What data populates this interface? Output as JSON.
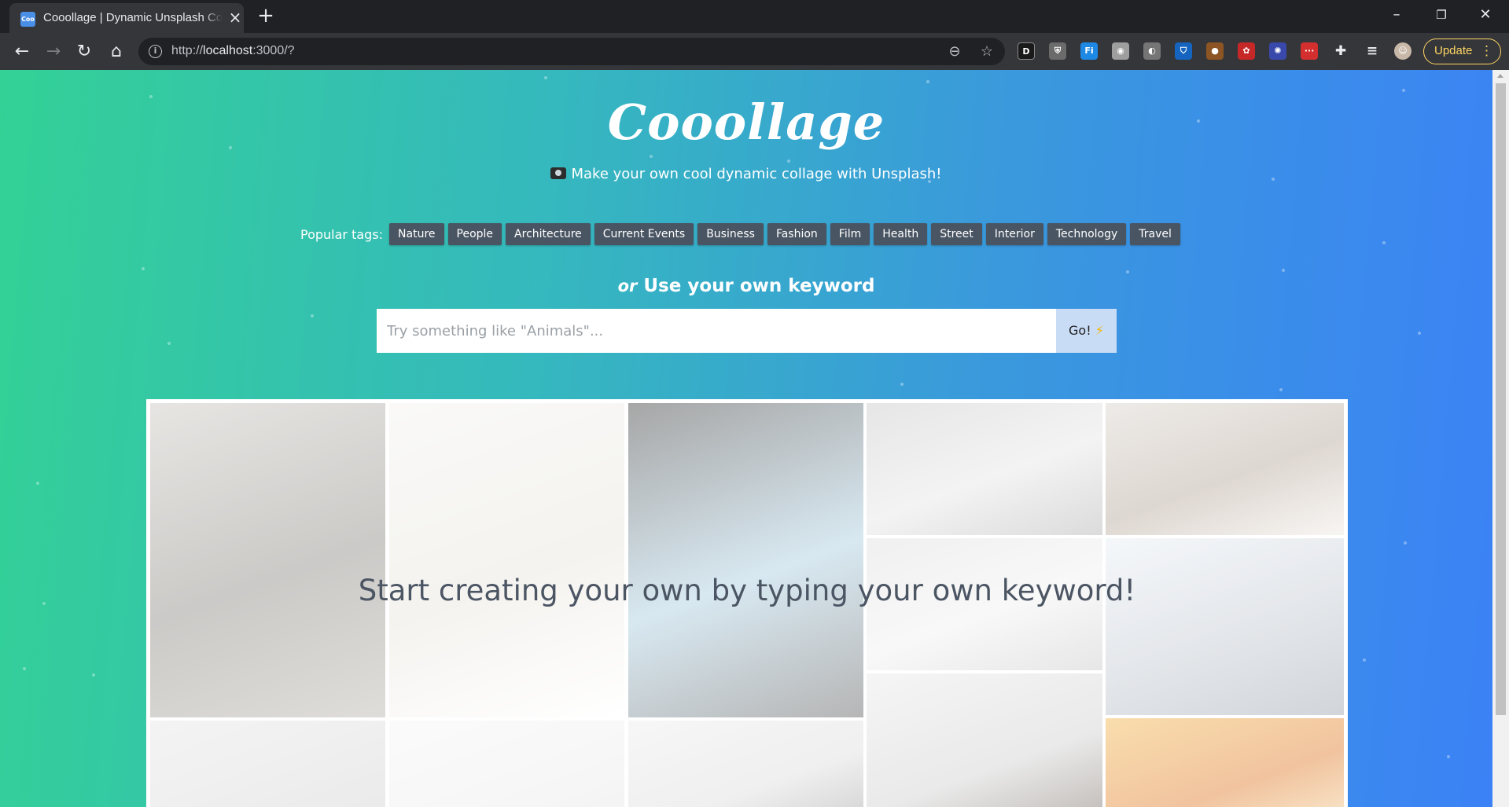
{
  "browser": {
    "tab_title": "Cooollage | Dynamic Unsplash Collage",
    "favicon_text": "Coo",
    "url_scheme": "http://",
    "url_host": "localhost",
    "url_rest": ":3000/?",
    "update_label": "Update"
  },
  "header": {
    "logo": "Cooollage",
    "tagline": "Make your own cool dynamic collage with Unsplash!"
  },
  "tags": {
    "label": "Popular tags:",
    "items": [
      "Nature",
      "People",
      "Architecture",
      "Current Events",
      "Business",
      "Fashion",
      "Film",
      "Health",
      "Street",
      "Interior",
      "Technology",
      "Travel"
    ]
  },
  "search": {
    "or_label": "or",
    "heading": "Use your own keyword",
    "placeholder": "Try something like \"Animals\"...",
    "value": "",
    "button_label": "Go!",
    "button_icon": "⚡"
  },
  "collage": {
    "message": "Start creating your own by typing your own keyword!",
    "tiles": [
      {
        "name": "tower-bridge-photo",
        "colors": [
          "#c9c6c0",
          "#8d8a84",
          "#b8b3ab"
        ]
      },
      {
        "name": "coffee-sunglasses-photo",
        "colors": [
          "#f3f2ef",
          "#e8e4dc",
          "#ffffff"
        ]
      },
      {
        "name": "mountain-silhouette-photo",
        "colors": [
          "#3b3b3b",
          "#a9cde0",
          "#5d5d5d"
        ]
      },
      {
        "name": "bed-sheet-photo",
        "colors": [
          "#c8c8c8",
          "#e5e5e5",
          "#b0b0b0"
        ]
      },
      {
        "name": "woman-camera-photo",
        "colors": [
          "#d8d3cc",
          "#b6a79a",
          "#efeae4"
        ]
      },
      {
        "name": "travel-flatlay-photo",
        "colors": [
          "#dedede",
          "#f0f0f0",
          "#c9c9c9"
        ]
      },
      {
        "name": "snowy-mountains-photo",
        "colors": [
          "#e8eef5",
          "#c2c8d0",
          "#9aa3ad"
        ]
      },
      {
        "name": "woman-back-photo",
        "colors": [
          "#e9e9e9",
          "#cfcfcf",
          "#5b4a40"
        ]
      },
      {
        "name": "flowers-photo",
        "colors": [
          "#f2b54a",
          "#e07b2a",
          "#f7e2a8"
        ]
      },
      {
        "name": "grey-sky-photo",
        "colors": [
          "#e6e6e6",
          "#d9d9d9",
          "#cccccc"
        ]
      },
      {
        "name": "small-object-photo",
        "colors": [
          "#f5f5f5",
          "#ededed",
          "#e0e0e0"
        ]
      },
      {
        "name": "dark-stripe-photo",
        "colors": [
          "#ececec",
          "#dcdcdc",
          "#888888"
        ]
      }
    ]
  }
}
